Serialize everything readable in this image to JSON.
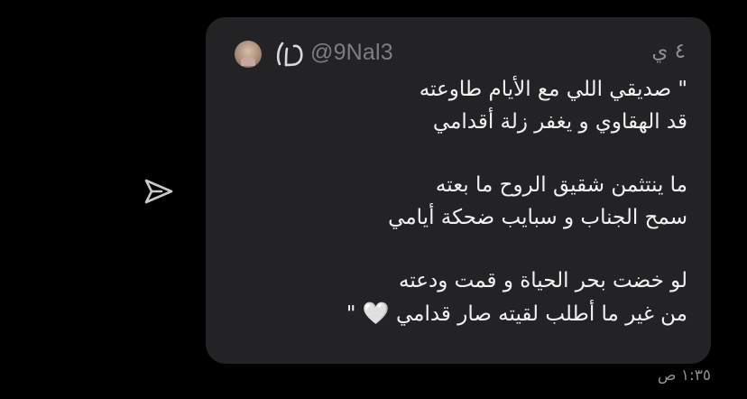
{
  "post": {
    "handle": "@9Nal3",
    "time_ago": "٤ ي",
    "stanzas": [
      [
        "\" صديقي اللي مع الأيام طاوعته",
        "قد الهقاوي و يغفر زلة أقدامي"
      ],
      [
        "ما ينتثمن شقيق الروح ما بعته",
        "سمح الجناب و سبايب ضحكة أيامي"
      ],
      [
        "لو خضت بحر الحياة و قمت ودعته",
        "من غير ما أطلب لقيته صار قدامي"
      ]
    ],
    "heart_emoji": "🤍",
    "closing_quote": "\"",
    "avatar_icon": "profile-photo",
    "verified_icon": "verified-badge-icon"
  },
  "share": {
    "icon": "send-arrow-icon"
  },
  "message": {
    "timestamp": "١:٣٥ ص"
  },
  "colors": {
    "background": "#000000",
    "bubble": "#232326",
    "text": "#f2f2f2",
    "muted": "#8e8e93"
  }
}
